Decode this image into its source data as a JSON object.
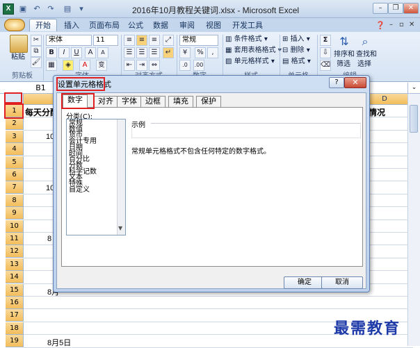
{
  "window": {
    "title": "2016年10月教程关键词.xlsx - Microsoft Excel",
    "app_icon_letter": "X"
  },
  "ribbon_tabs": [
    "开始",
    "插入",
    "页面布局",
    "公式",
    "数据",
    "审阅",
    "视图",
    "开发工具"
  ],
  "ribbon": {
    "clipboard": {
      "paste": "粘贴",
      "group": "剪贴板"
    },
    "font": {
      "name": "宋体",
      "size": "11",
      "group": "字体",
      "bold": "B",
      "italic": "I",
      "underline": "U",
      "grow": "A",
      "shrink": "A",
      "text_color": "A",
      "phonetic": "变"
    },
    "alignment": {
      "group": "对齐方式"
    },
    "number": {
      "format": "常规",
      "percent": "%",
      "comma": ",",
      "group": "数字"
    },
    "styles": {
      "conditional": "条件格式",
      "table": "套用表格格式",
      "cell": "单元格样式",
      "group": "样式"
    },
    "cells": {
      "insert": "插入",
      "delete": "删除",
      "format": "格式",
      "group": "单元格"
    },
    "editing": {
      "sort": "排序和",
      "sort2": "筛选",
      "find": "查找和",
      "find2": "选择",
      "group": "编辑"
    }
  },
  "formula_bar": {
    "namebox": "B1"
  },
  "sheet": {
    "rows": [
      "1",
      "2",
      "3",
      "4",
      "5",
      "6",
      "7",
      "8",
      "9",
      "10",
      "11",
      "12",
      "13",
      "14",
      "15",
      "16",
      "17",
      "18",
      "19"
    ],
    "col_d": "D",
    "a1": "每天分配",
    "d1": "情况",
    "cells_b": [
      {
        "row": 3,
        "text": "10"
      },
      {
        "row": 7,
        "text": "10"
      },
      {
        "row": 11,
        "text": "8"
      },
      {
        "row": 15,
        "text": "8月"
      },
      {
        "row": 19,
        "text": "8月5日"
      }
    ]
  },
  "dialog": {
    "title": "设置单元格格式",
    "tabs": [
      "数字",
      "对齐",
      "字体",
      "边框",
      "填充",
      "保护"
    ],
    "category_label": "分类(C):",
    "categories": [
      "常规",
      "数值",
      "货币",
      "会计专用",
      "日期",
      "时间",
      "百分比",
      "分数",
      "科学记数",
      "文本",
      "特殊",
      "自定义"
    ],
    "sample_label": "示例",
    "description": "常规单元格格式不包含任何特定的数字格式。",
    "ok": "确定",
    "cancel": "取消"
  },
  "watermark": "最需教育"
}
